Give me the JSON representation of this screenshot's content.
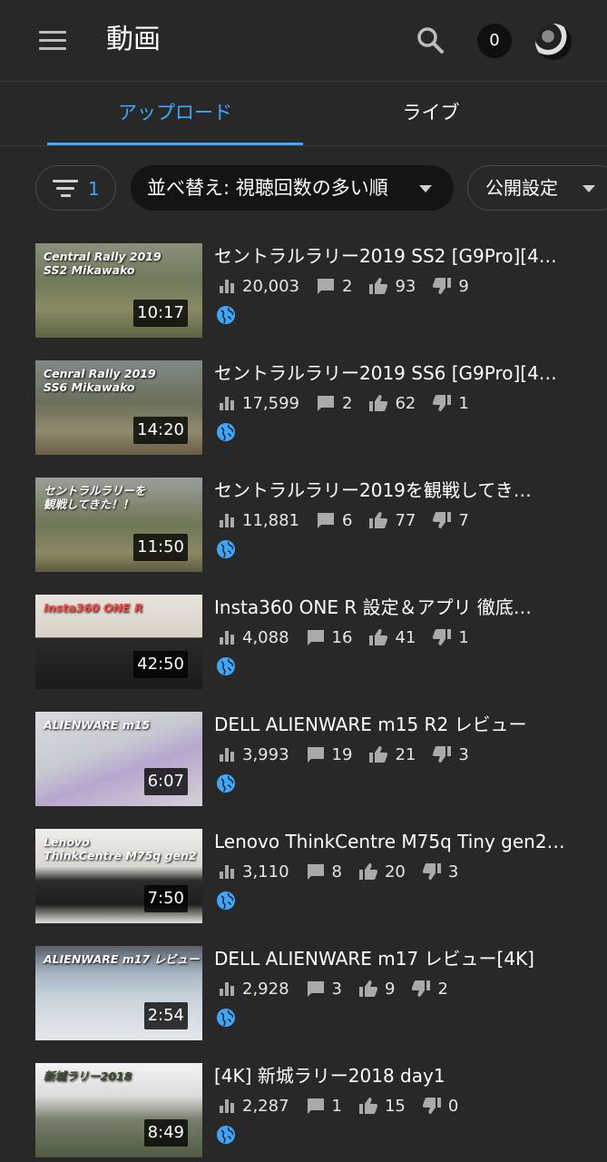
{
  "header": {
    "title": "動画",
    "notification_count": "0"
  },
  "tabs": [
    {
      "label": "アップロード",
      "active": true
    },
    {
      "label": "ライブ",
      "active": false
    }
  ],
  "filters": {
    "filter_count": "1",
    "sort_label": "並べ替え: 視聴回数の多い順",
    "visibility_label": "公開設定"
  },
  "colors": {
    "accent": "#3ea6ff",
    "background": "#282828"
  },
  "videos": [
    {
      "title": "セントラルラリー2019 SS2 [G9Pro][4…",
      "thumb_caption": "Central Rally 2019\nSS2 Mikawako",
      "duration": "10:17",
      "views": "20,003",
      "comments": "2",
      "likes": "93",
      "dislikes": "9"
    },
    {
      "title": "セントラルラリー2019 SS6 [G9Pro][4…",
      "thumb_caption": "Cenral Rally 2019\nSS6 Mikawako",
      "duration": "14:20",
      "views": "17,599",
      "comments": "2",
      "likes": "62",
      "dislikes": "1"
    },
    {
      "title": "セントラルラリー2019を観戦してき…",
      "thumb_caption": "セントラルラリーを\n観戦してきた！！",
      "duration": "11:50",
      "views": "11,881",
      "comments": "6",
      "likes": "77",
      "dislikes": "7"
    },
    {
      "title": "Insta360 ONE R 設定＆アプリ 徹底…",
      "thumb_caption": "Insta360 ONE R",
      "duration": "42:50",
      "views": "4,088",
      "comments": "16",
      "likes": "41",
      "dislikes": "1"
    },
    {
      "title": "DELL ALIENWARE m15 R2 レビュー",
      "thumb_caption": "ALIENWARE m15",
      "duration": "6:07",
      "views": "3,993",
      "comments": "19",
      "likes": "21",
      "dislikes": "3"
    },
    {
      "title": "Lenovo ThinkCentre M75q Tiny gen2…",
      "thumb_caption": "Lenovo\nThinkCentre M75q gen2",
      "duration": "7:50",
      "views": "3,110",
      "comments": "8",
      "likes": "20",
      "dislikes": "3"
    },
    {
      "title": "DELL ALIENWARE m17 レビュー[4K]",
      "thumb_caption": "ALIENWARE m17 レビュー",
      "duration": "2:54",
      "views": "2,928",
      "comments": "3",
      "likes": "9",
      "dislikes": "2"
    },
    {
      "title": "[4K] 新城ラリー2018 day1",
      "thumb_caption": "新城ラリー2018",
      "duration": "8:49",
      "views": "2,287",
      "comments": "1",
      "likes": "15",
      "dislikes": "0"
    }
  ]
}
